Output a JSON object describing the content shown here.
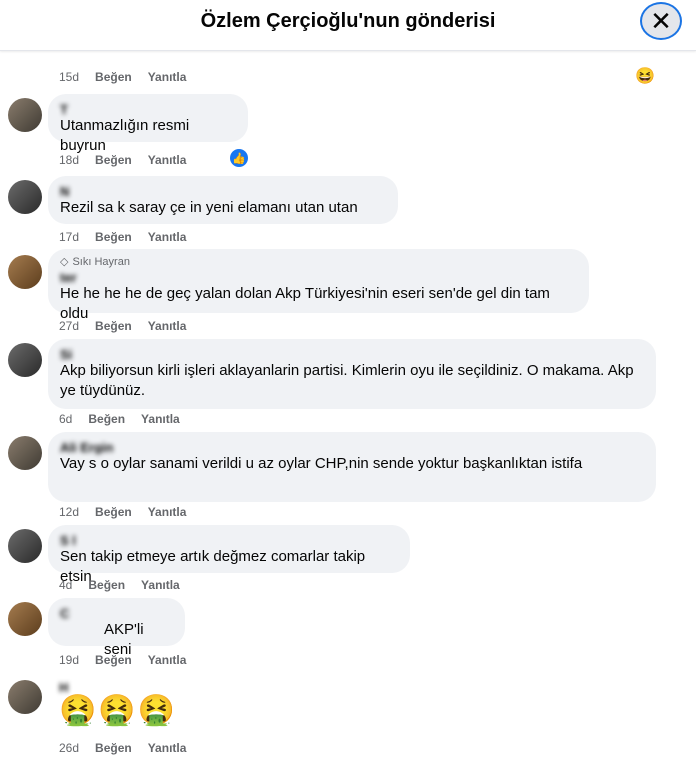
{
  "header": {
    "title": "Özlem Çerçioğlu'nun gönderisi",
    "close_glyph": "✕"
  },
  "actions": {
    "like": "Beğen",
    "reply": "Yanıtla"
  },
  "top_partial": {
    "emojis": "😂😂😄",
    "time": "15d",
    "reaction": "😆"
  },
  "comments": [
    {
      "author": "T",
      "text": "Utanmazlığın resmi buyrun",
      "time": "18d",
      "reaction": "👍"
    },
    {
      "author": "N",
      "text": "Rezil sa k saray çe in yeni elamanı utan utan",
      "time": "17d"
    },
    {
      "badge": "Sıkı Hayran",
      "author": "ter",
      "text": "He he he he de geç yalan dolan Akp Türkiyesi'nin eseri sen'de gel din tam oldu",
      "time": "27d"
    },
    {
      "author": "Si",
      "text": "Akp biliyorsun kirli işleri aklayanlarin partisi. Kimlerin oyu ile seçildiniz. O makama. Akp ye tüydünüz.",
      "time": "6d"
    },
    {
      "author": "Ali Ergin",
      "text": "Vay s o oylar sanami verildi u az oylar CHP,nin sende yoktur başkanlıktan istifa",
      "time": "12d"
    },
    {
      "author": "S l",
      "text": "Sen takip etmeye artık değmez comarlar takip etsin",
      "time": "4d"
    },
    {
      "author": "C",
      "text": "AKP'li seni",
      "time": "19d"
    },
    {
      "author": "H",
      "text": "🤮🤮🤮",
      "time": "26d"
    }
  ]
}
